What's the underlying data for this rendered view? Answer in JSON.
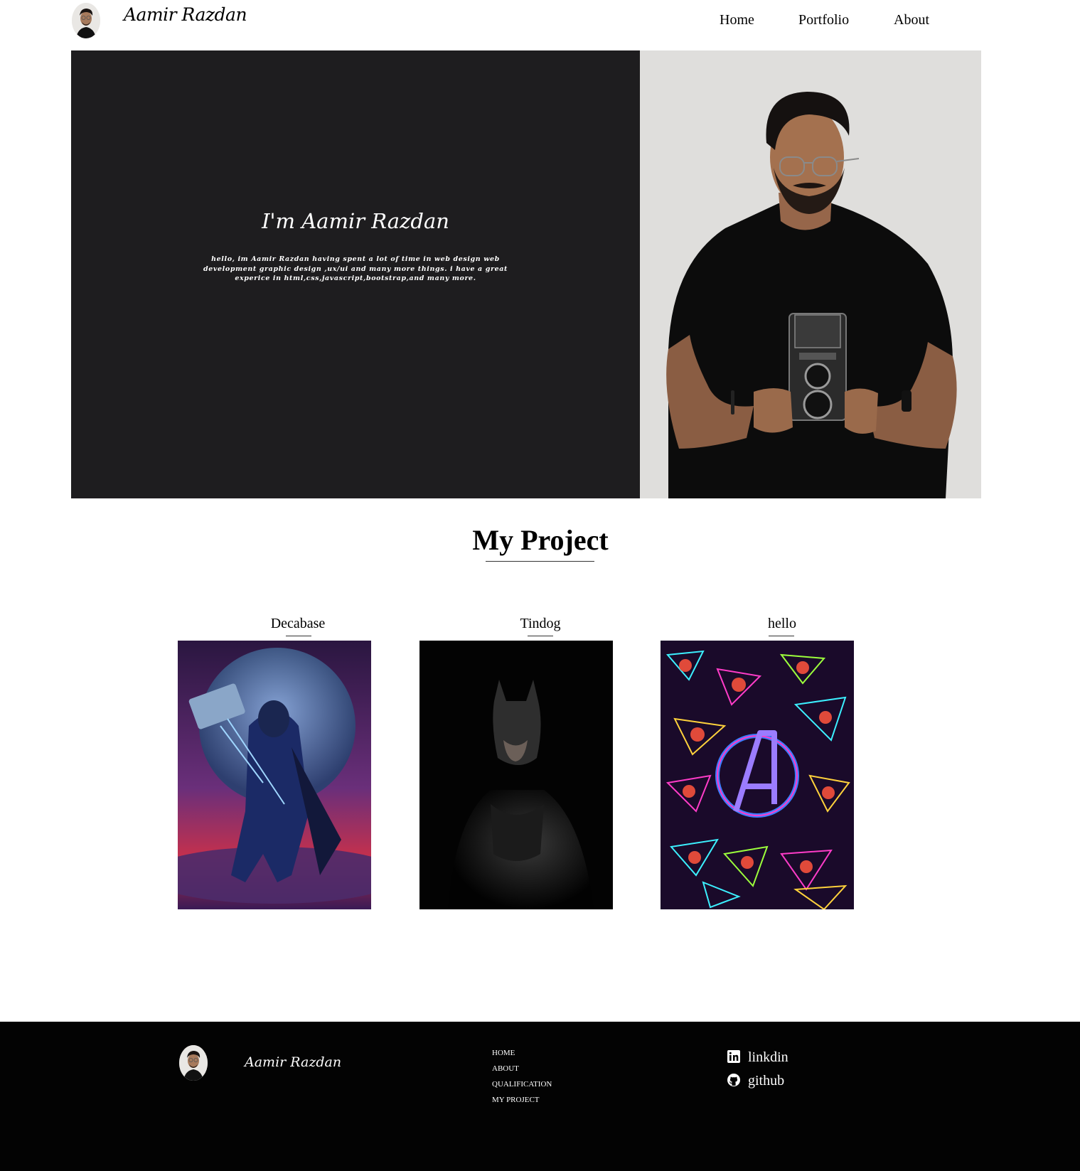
{
  "header": {
    "brand": "Aamir Razdan",
    "nav": [
      {
        "label": "Home"
      },
      {
        "label": "Portfolio"
      },
      {
        "label": "About"
      }
    ]
  },
  "hero": {
    "title": "I'm Aamir Razdan",
    "text": "hello, im Aamir Razdan having spent a lot of time in web design web development graphic design ,ux/ui and many more things. i have a great experice in html,css,javascript,bootstrap,and many more.",
    "colors": {
      "panel": "#1e1d1f",
      "photo_bg": "#dfdedc"
    }
  },
  "projects": {
    "title": "My Project",
    "items": [
      {
        "title": "Decabase",
        "image": "thor-icon"
      },
      {
        "title": "Tindog",
        "image": "batman-icon"
      },
      {
        "title": "hello",
        "image": "avengers-icon"
      }
    ]
  },
  "footer": {
    "brand": "Aamir Razdan",
    "links": [
      "HOME",
      "ABOUT",
      "QUALIFICATION",
      "MY PROJECT"
    ],
    "social": [
      {
        "label": "linkdin",
        "icon": "linkedin-icon"
      },
      {
        "label": "github",
        "icon": "github-icon"
      }
    ],
    "background": "#030303"
  }
}
